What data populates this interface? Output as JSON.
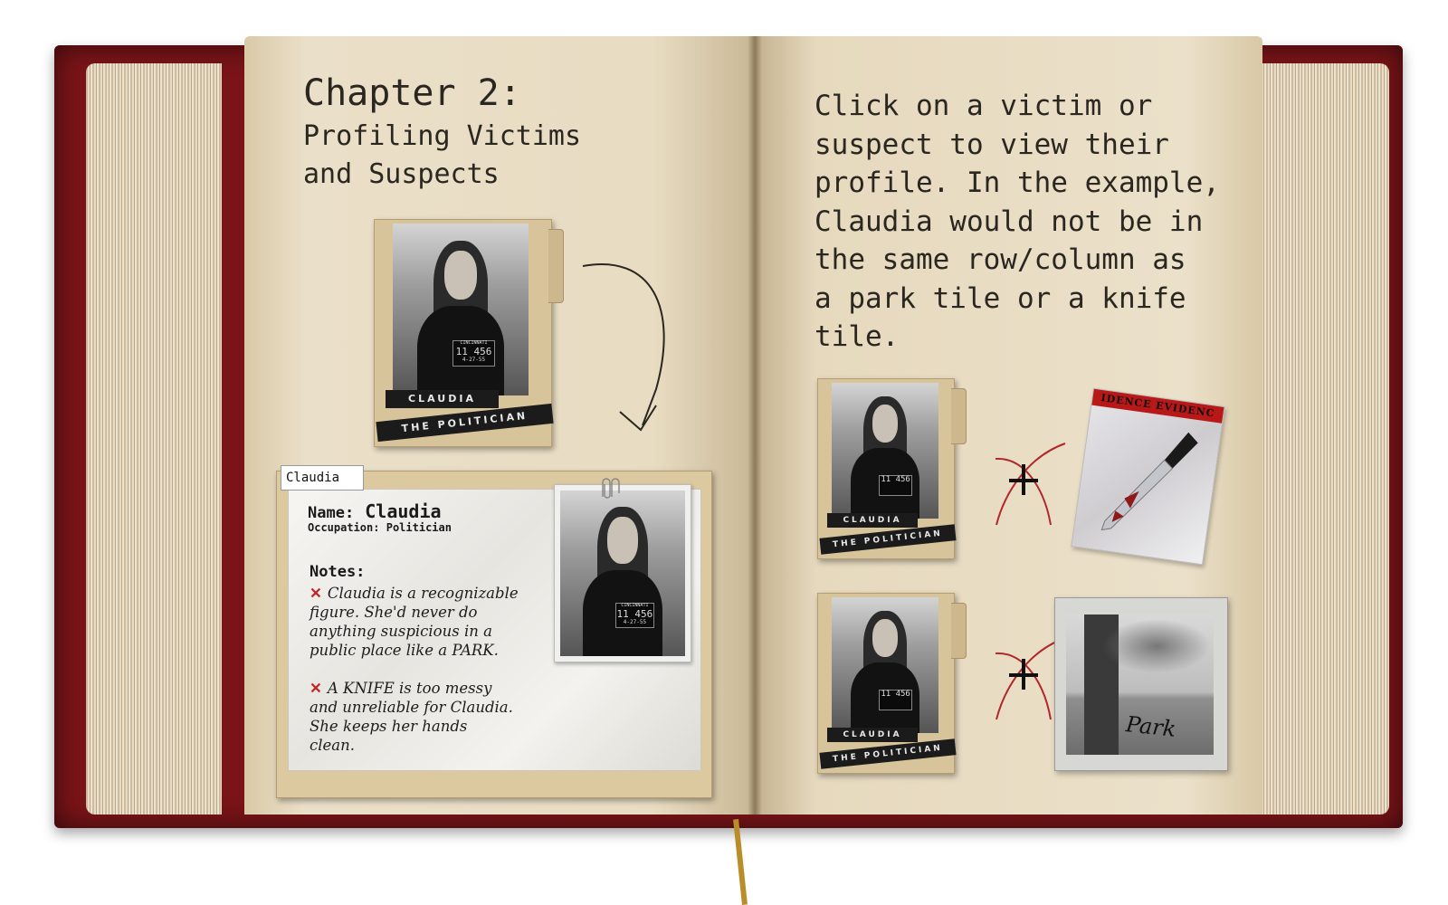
{
  "colors": {
    "cover": "#7a1418",
    "paper": "#e8dcc2",
    "ink": "#2a2620",
    "accent_red": "#c0282c",
    "ribbon": "#b88d2a"
  },
  "left_page": {
    "chapter_title": "Chapter 2:",
    "chapter_subtitle_line1": "Profiling Victims",
    "chapter_subtitle_line2": "and Suspects",
    "suspect_card": {
      "name_label": "CLAUDIA",
      "role_label": "THE POLITICIAN",
      "mug_lines": [
        "CINCINNATI",
        "POLICE DEPARTMENT",
        "11 456",
        "4-27-55"
      ]
    },
    "profile": {
      "tab_label": "Claudia",
      "name_label": "Name:",
      "name_value": "Claudia",
      "occupation_label": "Occupation:",
      "occupation_value": "Politician",
      "notes_label": "Notes:",
      "note1_line1": "Claudia is a recognizable",
      "note1_line2": "figure. She'd never do",
      "note1_line3": "anything suspicious in a",
      "note1_line4": "public place like a PARK.",
      "note2_line1": "A KNIFE is too messy",
      "note2_line2": "and unreliable for Claudia.",
      "note2_line3": "She keeps her hands",
      "note2_line4": "clean."
    }
  },
  "right_page": {
    "instructions": [
      "Click on a victim or",
      "suspect to view their",
      "profile. In the example,",
      "Claudia would not be in",
      "the same row/column as",
      "a park tile or a knife",
      "tile."
    ],
    "example_rows": [
      {
        "suspect_name": "CLAUDIA",
        "suspect_role": "THE POLITICIAN",
        "evidence": "knife",
        "evidence_tape": "IDENCE  EVIDENC"
      },
      {
        "suspect_name": "CLAUDIA",
        "suspect_role": "THE POLITICIAN",
        "evidence": "park",
        "evidence_caption": "Park"
      }
    ]
  }
}
